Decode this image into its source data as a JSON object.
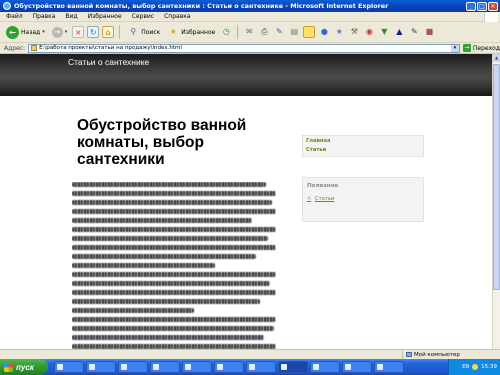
{
  "window": {
    "title": "Обустройство ванной комнаты, выбор сантехники : Статьи о сантехнике - Microsoft Internet Explorer",
    "controls": [
      "_",
      "□",
      "×"
    ]
  },
  "menu": {
    "items": [
      "Файл",
      "Правка",
      "Вид",
      "Избранное",
      "Сервис",
      "Справка"
    ]
  },
  "toolbar": {
    "back_label": "Назад",
    "search_label": "Поиск",
    "favorites_label": "Избранное"
  },
  "address": {
    "label": "Адрес:",
    "value": "E:\\работа проекты\\статьи на продажу\\index.html",
    "go_label": "Переход"
  },
  "page": {
    "site_title": "Статьи о сантехнике",
    "article_title": "Обустройство ванной комнаты, выбор сантехники",
    "nav": {
      "links": [
        "Главная",
        "Статьи"
      ]
    },
    "useful": {
      "title": "Полезное",
      "items": [
        "Статьи"
      ]
    }
  },
  "status": {
    "zone_label": "Мой компьютер"
  },
  "taskbar": {
    "start_label": "пуск",
    "time": "15:39",
    "lang": "EN"
  },
  "colors": {
    "link": "#6a8a1e",
    "title_bar": "#0a5ed8",
    "banner": "#2f2f2f"
  }
}
